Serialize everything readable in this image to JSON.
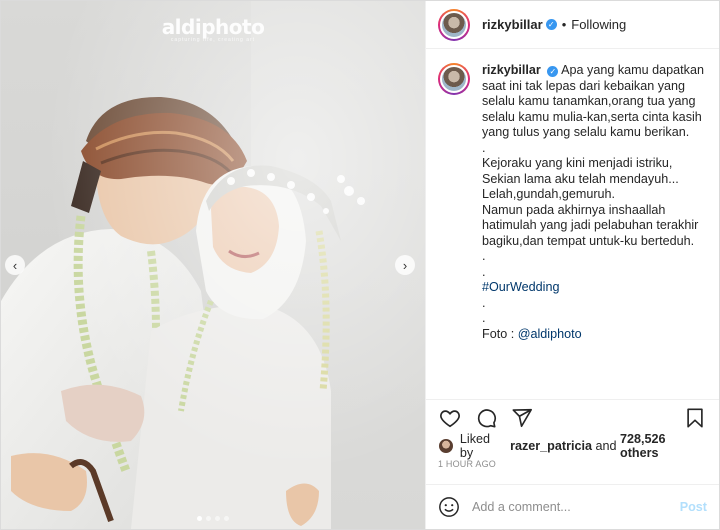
{
  "media": {
    "watermark_logo": "aldiphoto",
    "watermark_tagline": "capturing life, creating art",
    "prev_icon": "chevron-left-icon",
    "next_icon": "chevron-right-icon",
    "slide_count": 4,
    "active_slide": 1
  },
  "header": {
    "username": "rizkybillar",
    "separator": "•",
    "follow_status": "Following"
  },
  "caption": {
    "username": "rizkybillar",
    "lines": [
      "Apa yang kamu dapatkan saat ini tak lepas dari kebaikan yang selalu kamu tanamkan,orang tua yang selalu kamu mulia-kan,serta cinta kasih yang tulus yang selalu kamu berikan.",
      ".",
      "Kejoraku yang kini menjadi istriku,",
      "Sekian lama aku telah mendayuh...",
      "Lelah,gundah,gemuruh.",
      "Namun pada akhirnya inshaallah hatimulah yang jadi pelabuhan terakhir bagiku,dan tempat untuk-ku berteduh.",
      ".",
      ".",
      "#OurWedding",
      ".",
      "."
    ],
    "credit_prefix": "Foto : ",
    "credit_mention": "@aldiphoto"
  },
  "actions": {
    "like_icon": "heart-icon",
    "comment_icon": "comment-icon",
    "share_icon": "share-icon",
    "save_icon": "bookmark-icon"
  },
  "likes": {
    "prefix": "Liked by ",
    "user": "razer_patricia",
    "middle": " and ",
    "count": "728,526 others"
  },
  "timestamp": "1 HOUR AGO",
  "comment_box": {
    "placeholder": "Add a comment...",
    "post_label": "Post"
  },
  "colors": {
    "verified": "#3897f0",
    "link": "#00376b",
    "post_disabled": "#b2dffc"
  }
}
